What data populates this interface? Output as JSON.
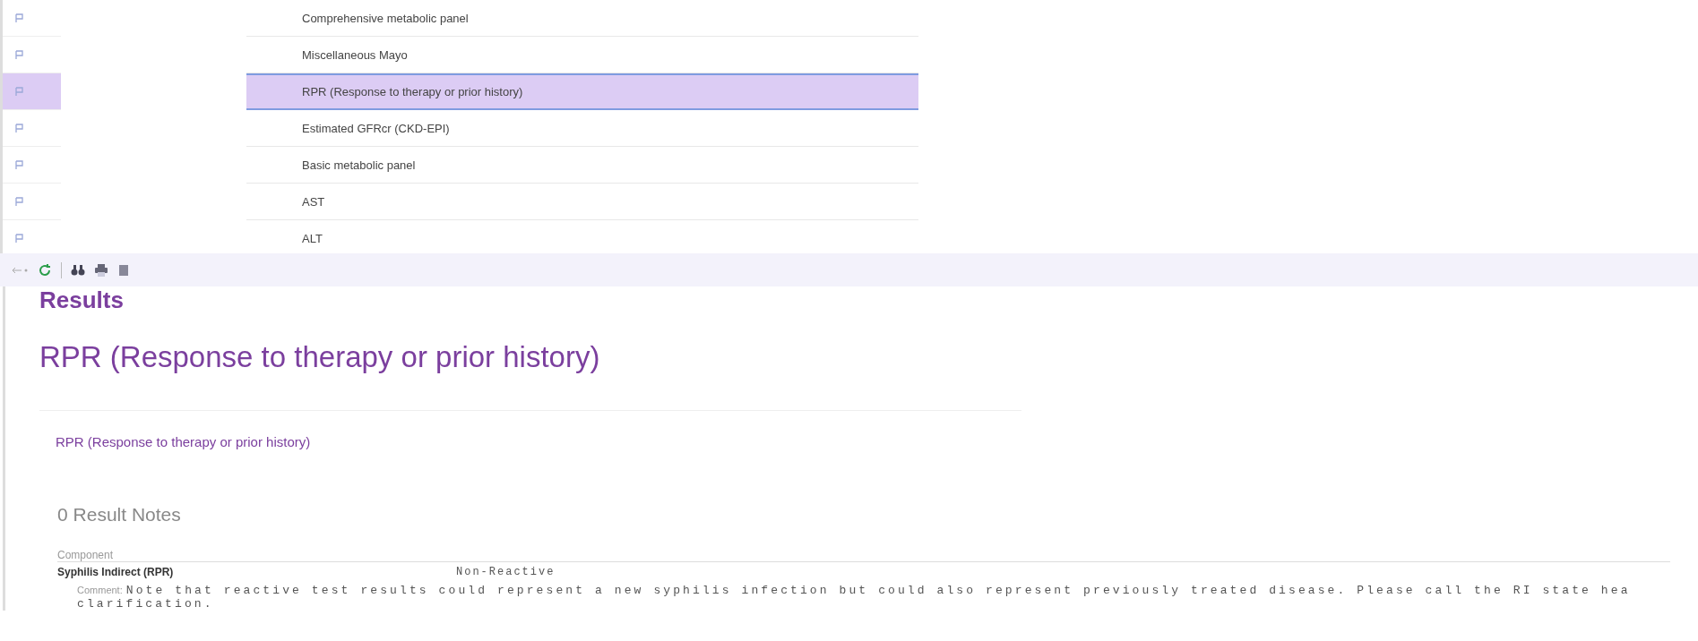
{
  "orders": [
    {
      "name": "Comprehensive metabolic panel",
      "selected": false
    },
    {
      "name": "Miscellaneous Mayo",
      "selected": false
    },
    {
      "name": "RPR (Response to therapy or prior history)",
      "selected": true
    },
    {
      "name": "Estimated GFRcr (CKD-EPI)",
      "selected": false
    },
    {
      "name": "Basic metabolic panel",
      "selected": false
    },
    {
      "name": "AST",
      "selected": false
    },
    {
      "name": "ALT",
      "selected": false
    }
  ],
  "results": {
    "heading": "Results",
    "title": "RPR (Response to therapy or prior history)",
    "card_title": "RPR (Response to therapy or prior history)",
    "notes": {
      "count": "0",
      "label": "Result Notes"
    },
    "column": "Component",
    "components": [
      {
        "name": "Syphilis Indirect (RPR)",
        "value": "Non-Reactive",
        "comment_label": "Comment:",
        "comment": [
          "Note that reactive test results could represent a new syphilis infection but could also represent previously treated disease. Please call the RI state hea",
          "clarification."
        ]
      }
    ]
  }
}
